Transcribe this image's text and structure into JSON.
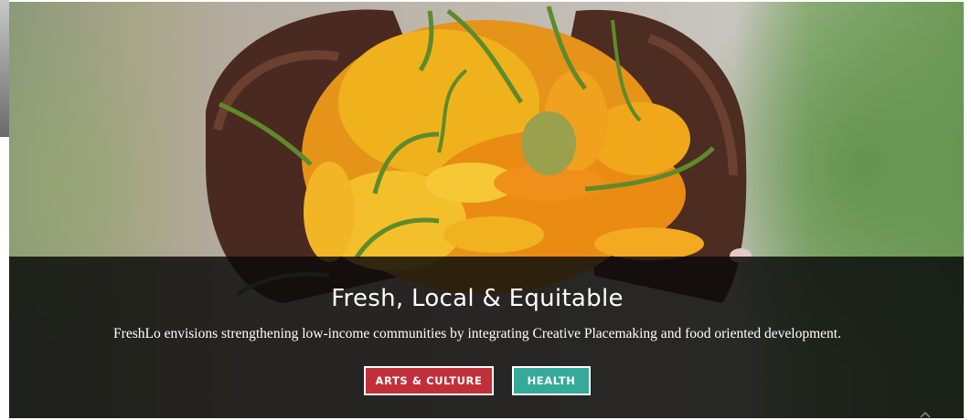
{
  "hero": {
    "image_alt": "Hands holding a heap of yellow and orange peppers",
    "title": "Fresh, Local & Equitable",
    "subtitle": "FreshLo envisions strengthening low-income communities by integrating Creative Placemaking and food oriented development."
  },
  "buttons": {
    "arts_culture": "ARTS & CULTURE",
    "health": "HEALTH"
  },
  "colors": {
    "arts_button": "#c1303a",
    "health_button": "#35aa9b",
    "overlay": "#0a0a0a",
    "pepper_yellow": "#f0b21c",
    "pepper_orange": "#ea8b14"
  },
  "icons": {
    "scroll": "chevron-up-icon"
  }
}
